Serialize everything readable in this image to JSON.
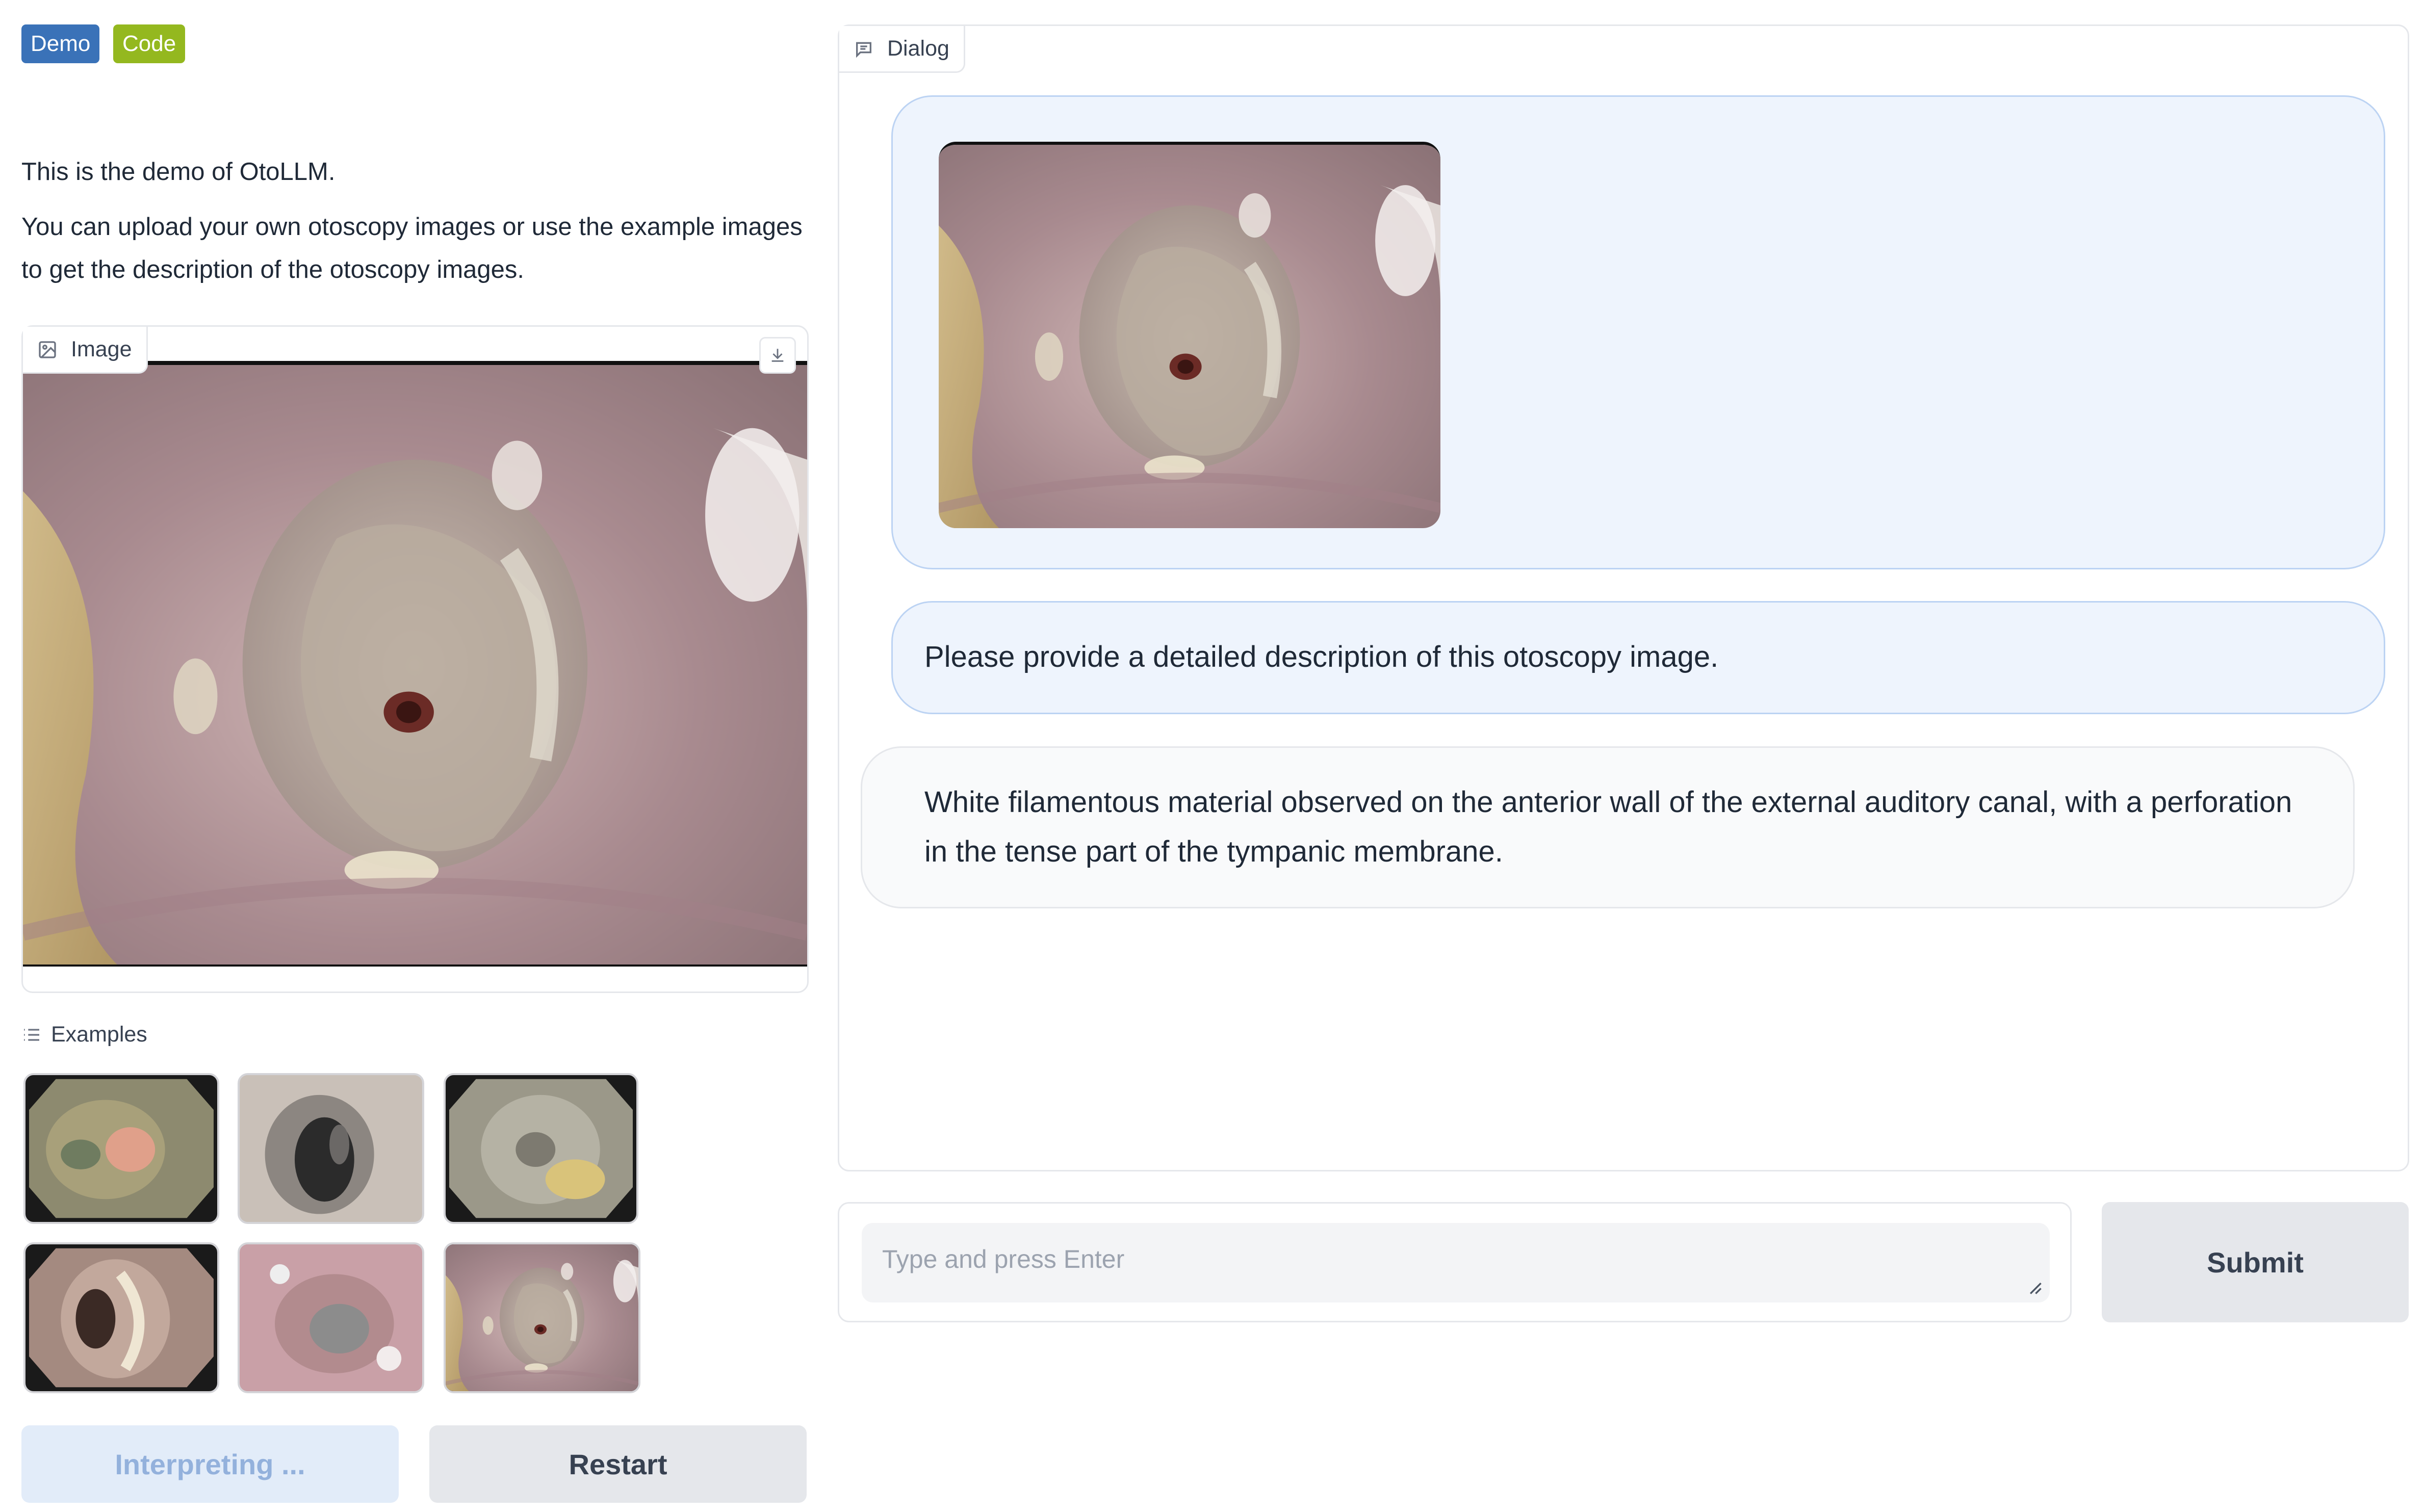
{
  "header": {
    "badges": [
      {
        "label": "Demo",
        "color": "#3a72b8"
      },
      {
        "label": "Code",
        "color": "#94b81f"
      }
    ]
  },
  "intro": {
    "line1": "This is the demo of OtoLLM.",
    "line2": "You can upload your own otoscopy images or use the example images to get the description of the otoscopy images."
  },
  "image_panel": {
    "label": "Image",
    "label_icon": "image-icon",
    "download_icon": "download-icon"
  },
  "examples": {
    "label": "Examples",
    "label_icon": "list-icon",
    "items": [
      {
        "name": "example-otoscopy-1"
      },
      {
        "name": "example-otoscopy-2"
      },
      {
        "name": "example-otoscopy-3"
      },
      {
        "name": "example-otoscopy-4"
      },
      {
        "name": "example-otoscopy-5"
      },
      {
        "name": "example-otoscopy-6"
      }
    ]
  },
  "actions": {
    "interpret_label": "Interpreting ...",
    "restart_label": "Restart"
  },
  "dialog": {
    "label": "Dialog",
    "label_icon": "chat-icon",
    "messages": [
      {
        "role": "user",
        "type": "image"
      },
      {
        "role": "user",
        "type": "text",
        "text": "Please provide a detailed description of this otoscopy image."
      },
      {
        "role": "assistant",
        "type": "text",
        "text": "White filamentous material observed on the anterior wall of the external auditory canal, with a perforation in the tense part of the tympanic membrane."
      }
    ]
  },
  "input": {
    "placeholder": "Type and press Enter",
    "value": "",
    "submit_label": "Submit"
  },
  "colors": {
    "accent": "#3a72b8",
    "user_bubble": "#eef4fd",
    "assistant_bubble": "#f9fafb",
    "button_gray": "#e5e7eb",
    "button_disabled": "#e2ecf9"
  }
}
